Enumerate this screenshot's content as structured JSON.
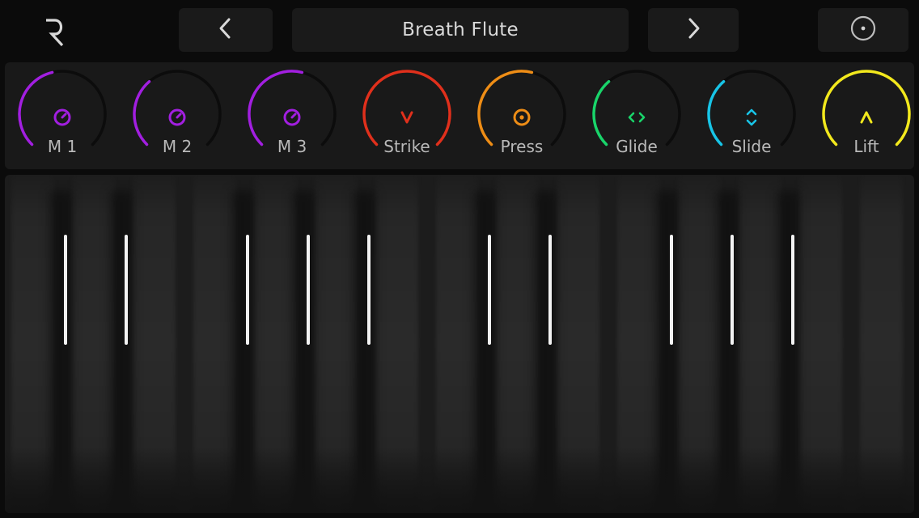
{
  "header": {
    "logo_icon": "roli-logo-icon",
    "prev_icon": "chevron-left-icon",
    "preset_name": "Breath Flute",
    "next_icon": "chevron-right-icon",
    "settings_icon": "circle-dot-icon"
  },
  "dials": [
    {
      "label": "M 1",
      "color": "#a21fe0",
      "icon": "knob-icon",
      "level": 0.45
    },
    {
      "label": "M 2",
      "color": "#a21fe0",
      "icon": "knob-icon",
      "level": 0.35
    },
    {
      "label": "M 3",
      "color": "#a21fe0",
      "icon": "knob-icon",
      "level": 0.55
    },
    {
      "label": "Strike",
      "color": "#e0301c",
      "icon": "chevron-down-icon",
      "level": 1.0
    },
    {
      "label": "Press",
      "color": "#ee8d16",
      "icon": "target-icon",
      "level": 0.55
    },
    {
      "label": "Glide",
      "color": "#19d46a",
      "icon": "left-right-arrows-icon",
      "level": 0.35
    },
    {
      "label": "Slide",
      "color": "#18c4e6",
      "icon": "up-down-arrows-icon",
      "level": 0.35
    },
    {
      "label": "Lift",
      "color": "#f2e81d",
      "icon": "chevron-up-icon",
      "level": 1.0
    }
  ],
  "keyboard": {
    "white_key_count": 15,
    "marker_color": "#f2f2f2"
  }
}
